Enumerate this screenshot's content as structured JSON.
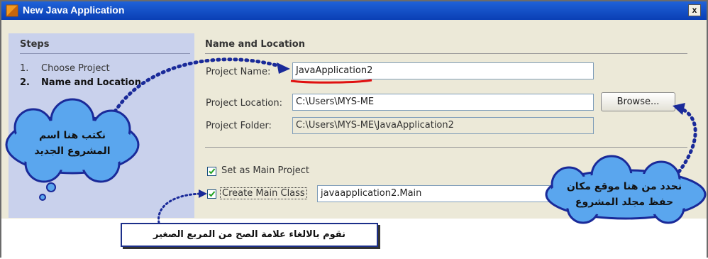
{
  "window": {
    "title": "New Java Application",
    "close_label": "x"
  },
  "steps": {
    "heading": "Steps",
    "items": [
      {
        "num": "1.",
        "label": "Choose Project"
      },
      {
        "num": "2.",
        "label": "Name and Location"
      }
    ]
  },
  "main": {
    "heading": "Name and Location",
    "project_name": {
      "label": "Project Name:",
      "value": "JavaApplication2"
    },
    "project_location": {
      "label": "Project Location:",
      "value": "C:\\Users\\MYS-ME",
      "browse_label": "Browse..."
    },
    "project_folder": {
      "label": "Project Folder:",
      "value": "C:\\Users\\MYS-ME\\JavaApplication2"
    },
    "set_main": {
      "label": "Set as Main Project",
      "checked": true
    },
    "create_main": {
      "label": "Create Main Class",
      "value": "javaapplication2.Main",
      "checked": true
    }
  },
  "annotations": {
    "callout_name_line1": "نكتب هنا اسم",
    "callout_name_line2": "المشروع الجديد",
    "callout_location_line1": "نحدد من هنا موقع مكان",
    "callout_location_line2": "حفظ مجلد المشروع",
    "note_box": "نقوم بالالغاء علامة الصح من المربع الصغير"
  },
  "colors": {
    "titlebar": "#0a3fb5",
    "steps_bg": "#c9d1ec",
    "callout": "#5aa6ee",
    "underline": "#e01010",
    "arrow": "#1a2a99"
  }
}
